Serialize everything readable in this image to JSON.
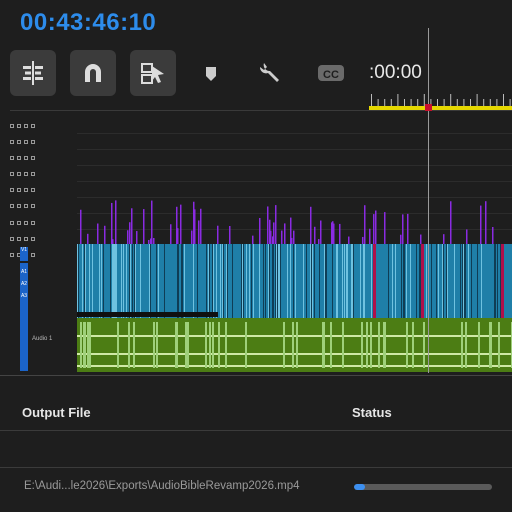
{
  "timecode": "00:43:46:10",
  "toolbar": {
    "tools": [
      {
        "name": "insert-edit-icon",
        "active": true
      },
      {
        "name": "snap-magnet-icon",
        "active": true
      },
      {
        "name": "linked-selection-icon",
        "active": true
      },
      {
        "name": "add-marker-icon",
        "active": false
      },
      {
        "name": "wrench-settings-icon",
        "active": false
      },
      {
        "name": "closed-captions-icon",
        "label": "CC",
        "active": false
      }
    ]
  },
  "ruler": {
    "time_label": ":00:00"
  },
  "tracks": {
    "video_tag": "V1",
    "audio_tags": [
      "A1",
      "A2",
      "A3"
    ],
    "audio_label": "Audio 1"
  },
  "queue": {
    "columns": {
      "output": "Output File",
      "status": "Status"
    },
    "items": [
      {
        "file": "E:\\Audi...le2026\\Exports\\AudioBibleRevamp2026.mp4",
        "progress": 0.08
      }
    ]
  },
  "colors": {
    "accent": "#2d8ceb",
    "video_clip": "#1f7fa8",
    "audio_clip": "#4c7d14",
    "marker_purple": "#8a2be2",
    "ruler_yellow": "#e6d800"
  }
}
